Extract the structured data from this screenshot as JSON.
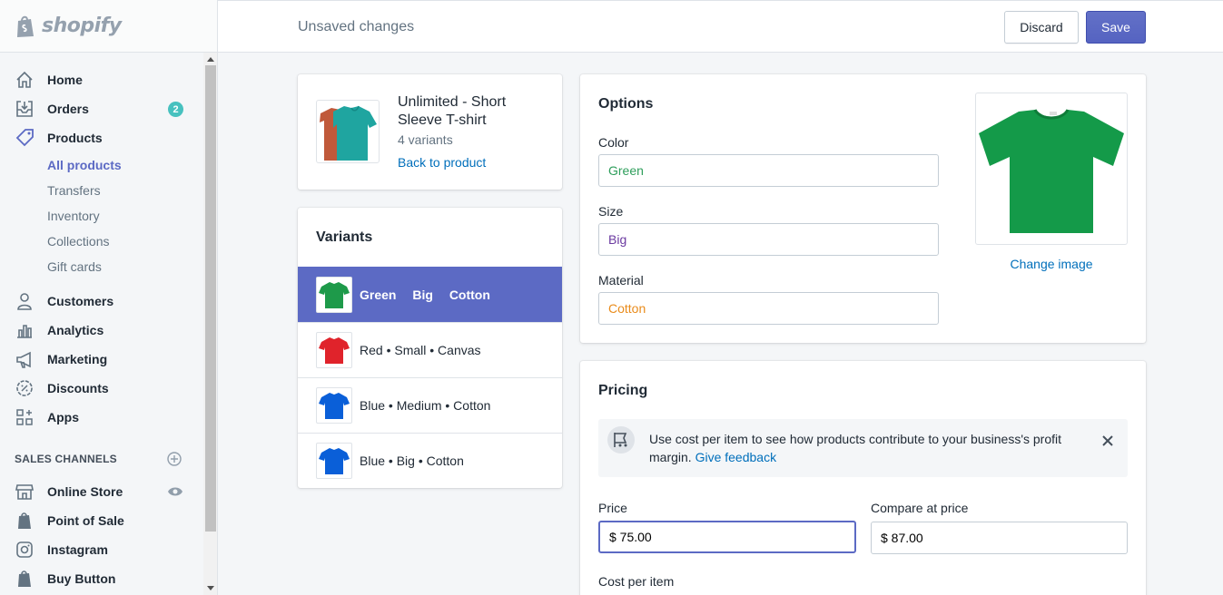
{
  "app": {
    "brand": "shopify"
  },
  "sidebar": {
    "items": [
      {
        "label": "Home",
        "icon": "home-icon"
      },
      {
        "label": "Orders",
        "icon": "orders-icon",
        "badge": "2"
      },
      {
        "label": "Products",
        "icon": "tag-icon"
      }
    ],
    "product_subitems": [
      "All products",
      "Transfers",
      "Inventory",
      "Collections",
      "Gift cards"
    ],
    "items2": [
      {
        "label": "Customers",
        "icon": "person-icon"
      },
      {
        "label": "Analytics",
        "icon": "bar-chart-icon"
      },
      {
        "label": "Marketing",
        "icon": "megaphone-icon"
      },
      {
        "label": "Discounts",
        "icon": "discount-icon"
      },
      {
        "label": "Apps",
        "icon": "apps-icon"
      }
    ],
    "sales_channels_heading": "SALES CHANNELS",
    "channels": [
      {
        "label": "Online Store",
        "icon": "store-icon"
      },
      {
        "label": "Point of Sale",
        "icon": "shopify-bag-icon"
      },
      {
        "label": "Instagram",
        "icon": "instagram-icon"
      },
      {
        "label": "Buy Button",
        "icon": "shopify-bag-icon"
      }
    ]
  },
  "topbar": {
    "status": "Unsaved changes",
    "discard_label": "Discard",
    "save_label": "Save"
  },
  "product": {
    "title": "Unlimited - Short Sleeve T-shirt",
    "variants_count": "4 variants",
    "back_link": "Back to product"
  },
  "variants": {
    "title": "Variants",
    "selected": [
      "Green",
      "Big",
      "Cotton"
    ],
    "rows": [
      {
        "label": "Red • Small • Canvas",
        "color": "#e0232b"
      },
      {
        "label": "Blue • Medium • Cotton",
        "color": "#0a5fd8"
      },
      {
        "label": "Blue • Big • Cotton",
        "color": "#0a5fd8"
      }
    ],
    "selected_color": "#1e9a4a"
  },
  "options": {
    "title": "Options",
    "color_label": "Color",
    "color_value": "Green",
    "color_value_color": "#2e9e5b",
    "size_label": "Size",
    "size_value": "Big",
    "size_value_color": "#6b3aa0",
    "material_label": "Material",
    "material_value": "Cotton",
    "material_value_color": "#e98b1b",
    "change_image": "Change image"
  },
  "pricing": {
    "title": "Pricing",
    "banner_text": "Use cost per item to see how products contribute to your business's profit margin.",
    "banner_link": "Give feedback",
    "price_label": "Price",
    "price_value": "$ 75.00",
    "compare_label": "Compare at price",
    "compare_value": "$ 87.00",
    "cost_label": "Cost per item"
  }
}
